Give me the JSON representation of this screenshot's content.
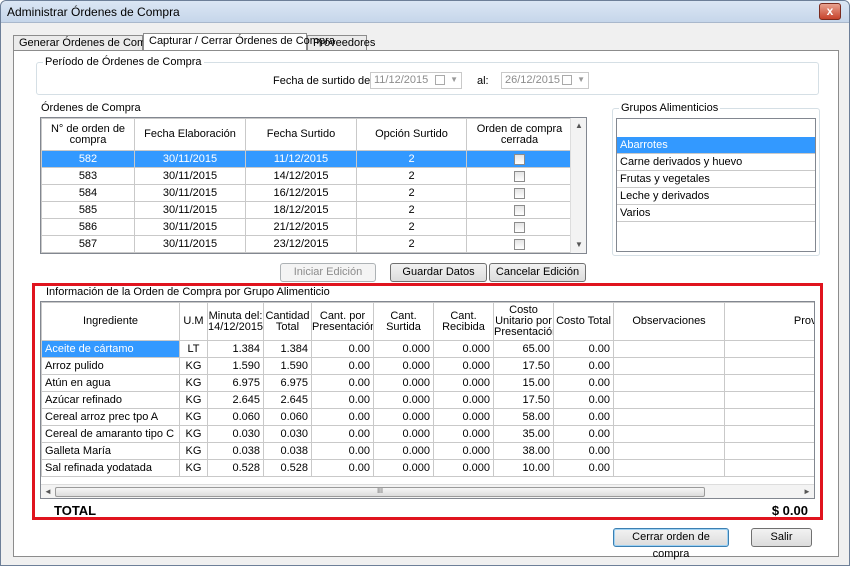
{
  "window": {
    "title": "Administrar Órdenes de Compra",
    "close_label": "x"
  },
  "tabs": [
    {
      "label": "Generar Órdenes de Compra."
    },
    {
      "label": "Capturar / Cerrar Órdenes de Compra"
    },
    {
      "label": "Proveedores"
    }
  ],
  "periodo": {
    "legend": "Período de Órdenes de Compra",
    "from_label": "Fecha de surtido del:",
    "from_value": "11/12/2015",
    "to_label": "al:",
    "to_value": "26/12/2015"
  },
  "ordenes": {
    "legend": "Órdenes de Compra",
    "headers": [
      "N° de orden de compra",
      "Fecha Elaboración",
      "Fecha Surtido",
      "Opción Surtido",
      "Orden de compra cerrada"
    ],
    "rows": [
      {
        "num": "582",
        "elab": "30/11/2015",
        "surt": "11/12/2015",
        "opc": "2"
      },
      {
        "num": "583",
        "elab": "30/11/2015",
        "surt": "14/12/2015",
        "opc": "2"
      },
      {
        "num": "584",
        "elab": "30/11/2015",
        "surt": "16/12/2015",
        "opc": "2"
      },
      {
        "num": "585",
        "elab": "30/11/2015",
        "surt": "18/12/2015",
        "opc": "2"
      },
      {
        "num": "586",
        "elab": "30/11/2015",
        "surt": "21/12/2015",
        "opc": "2"
      },
      {
        "num": "587",
        "elab": "30/11/2015",
        "surt": "23/12/2015",
        "opc": "2"
      }
    ]
  },
  "grupos": {
    "legend": "Grupos Alimenticios",
    "items": [
      "Abarrotes",
      "Carne derivados y huevo",
      "Frutas y vegetales",
      "Leche y derivados",
      "Varios"
    ]
  },
  "buttons": {
    "iniciar": "Iniciar Edición",
    "guardar": "Guardar Datos",
    "cancelar": "Cancelar Edición",
    "cerrar": "Cerrar orden de compra",
    "salir": "Salir"
  },
  "info": {
    "legend": "Información de la Orden de Compra por Grupo Alimenticio",
    "headers": [
      "Ingrediente",
      "U.M",
      "Minuta del: 14/12/2015",
      "Cantidad Total",
      "Cant. por Presentación",
      "Cant. Surtida",
      "Cant. Recibida",
      "Costo Unitario por Presentación",
      "Costo Total",
      "Observaciones",
      "Proveedo"
    ],
    "rows": [
      {
        "ing": "Aceite de cártamo",
        "um": "LT",
        "min": "1.384",
        "tot": "1.384",
        "pres": "0.00",
        "surt": "0.000",
        "rec": "0.000",
        "cu": "65.00",
        "ct": "0.00"
      },
      {
        "ing": "Arroz pulido",
        "um": "KG",
        "min": "1.590",
        "tot": "1.590",
        "pres": "0.00",
        "surt": "0.000",
        "rec": "0.000",
        "cu": "17.50",
        "ct": "0.00"
      },
      {
        "ing": "Atún en agua",
        "um": "KG",
        "min": "6.975",
        "tot": "6.975",
        "pres": "0.00",
        "surt": "0.000",
        "rec": "0.000",
        "cu": "15.00",
        "ct": "0.00"
      },
      {
        "ing": "Azúcar refinado",
        "um": "KG",
        "min": "2.645",
        "tot": "2.645",
        "pres": "0.00",
        "surt": "0.000",
        "rec": "0.000",
        "cu": "17.50",
        "ct": "0.00"
      },
      {
        "ing": "Cereal arroz prec tpo A",
        "um": "KG",
        "min": "0.060",
        "tot": "0.060",
        "pres": "0.00",
        "surt": "0.000",
        "rec": "0.000",
        "cu": "58.00",
        "ct": "0.00"
      },
      {
        "ing": "Cereal de amaranto tipo C",
        "um": "KG",
        "min": "0.030",
        "tot": "0.030",
        "pres": "0.00",
        "surt": "0.000",
        "rec": "0.000",
        "cu": "35.00",
        "ct": "0.00"
      },
      {
        "ing": "Galleta María",
        "um": "KG",
        "min": "0.038",
        "tot": "0.038",
        "pres": "0.00",
        "surt": "0.000",
        "rec": "0.000",
        "cu": "38.00",
        "ct": "0.00"
      },
      {
        "ing": "Sal refinada yodatada",
        "um": "KG",
        "min": "0.528",
        "tot": "0.528",
        "pres": "0.00",
        "surt": "0.000",
        "rec": "0.000",
        "cu": "10.00",
        "ct": "0.00"
      }
    ],
    "scroll_grip": "III"
  },
  "total": {
    "label": "TOTAL",
    "value": "$ 0.00"
  },
  "colors": {
    "selection": "#3399ff",
    "highlight_border": "#e0141e"
  }
}
